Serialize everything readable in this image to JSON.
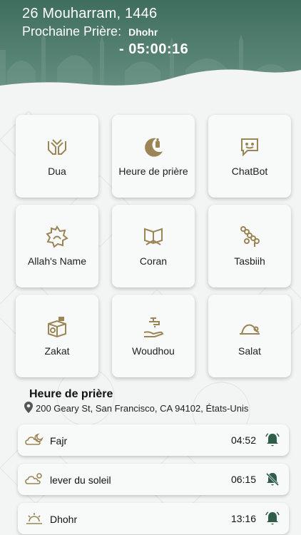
{
  "header": {
    "date": "26 Mouharram, 1446",
    "next_label": "Prochaine Prière:",
    "next_prayer": "Dhohr",
    "countdown": "- 05:00:16"
  },
  "menu": [
    {
      "label": "Dua",
      "icon": "dua-hands-icon"
    },
    {
      "label": "Heure de prière",
      "icon": "crescent-prayer-icon"
    },
    {
      "label": "ChatBot",
      "icon": "chatbot-icon"
    },
    {
      "label": "Allah's Name",
      "icon": "allah-name-icon"
    },
    {
      "label": "Coran",
      "icon": "quran-icon"
    },
    {
      "label": "Tasbiih",
      "icon": "tasbih-icon"
    },
    {
      "label": "Zakat",
      "icon": "zakat-box-icon"
    },
    {
      "label": "Woudhou",
      "icon": "ablution-tap-icon"
    },
    {
      "label": "Salat",
      "icon": "prostration-icon"
    }
  ],
  "prayer_times": {
    "title": "Heure de prière",
    "address": "200 Geary St, San Francisco, CA 94102, États-Unis",
    "rows": [
      {
        "name": "Fajr",
        "time": "04:52",
        "alarm": "on",
        "icon": "cloud-moon-icon"
      },
      {
        "name": "lever du soleil",
        "time": "06:15",
        "alarm": "off",
        "icon": "cloud-sun-icon"
      },
      {
        "name": "Dhohr",
        "time": "13:16",
        "alarm": "on",
        "icon": "sun-icon"
      }
    ]
  },
  "colors": {
    "header": "#3f6e5e",
    "accent_gold": "#9c8555",
    "bell_green": "#2e5e4a"
  }
}
